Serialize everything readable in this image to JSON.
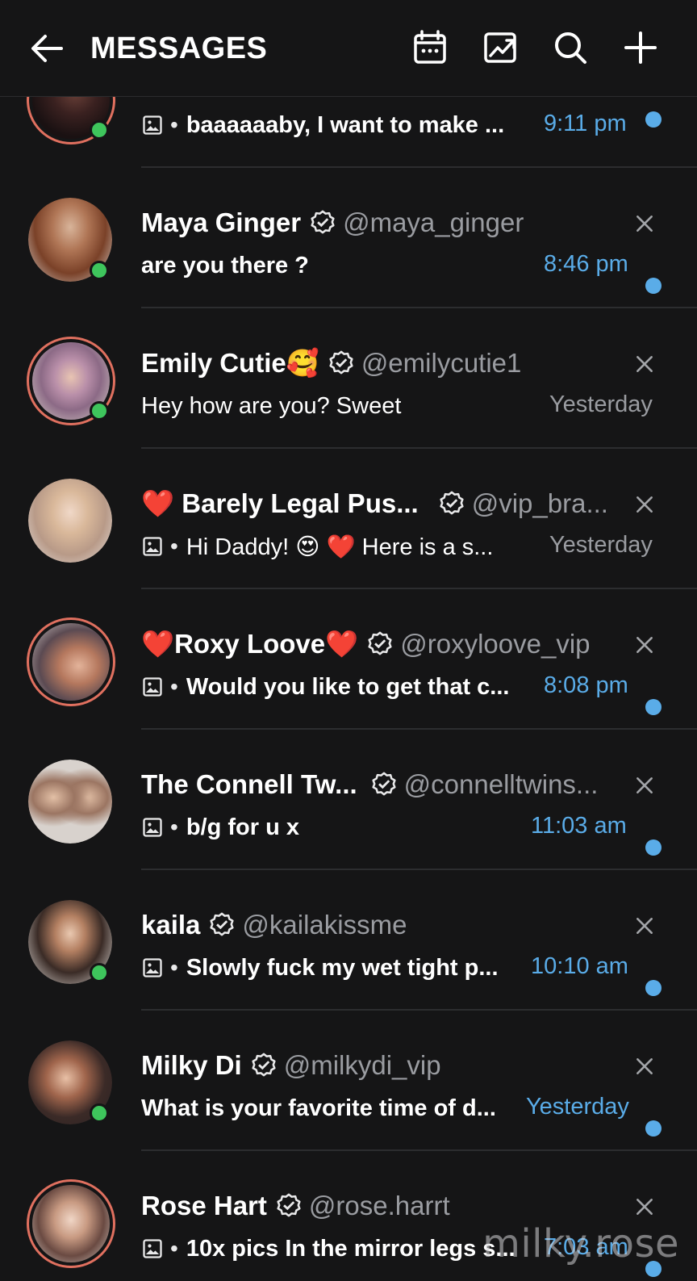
{
  "header": {
    "title": "MESSAGES"
  },
  "conversations": [
    {
      "name": "",
      "handle": "",
      "has_media": true,
      "message": "baaaaaaby, I want to make ...",
      "time": "9:11 pm",
      "unread": true,
      "online": true,
      "story_ring": true
    },
    {
      "name": "Maya Ginger",
      "handle": "@maya_ginger",
      "has_media": false,
      "message": "are you there ?",
      "time": "8:46 pm",
      "unread": true,
      "online": true,
      "story_ring": false
    },
    {
      "name": "Emily Cutie🥰",
      "handle": "@emilycutie1",
      "has_media": false,
      "message": "Hey how are you? Sweet",
      "time": "Yesterday",
      "unread": false,
      "online": true,
      "story_ring": true
    },
    {
      "name": "❤️ Barely Legal Pus...",
      "handle": "@vip_bra...",
      "has_media": true,
      "message": "Hi Daddy! 😍 ❤️ Here is a s...",
      "time": "Yesterday",
      "unread": false,
      "online": false,
      "story_ring": false
    },
    {
      "name": "❤️Roxy Loove❤️",
      "handle": "@roxyloove_vip",
      "has_media": true,
      "message": "Would you like to get that c...",
      "time": "8:08 pm",
      "unread": true,
      "online": false,
      "story_ring": true
    },
    {
      "name": "The Connell Tw...",
      "handle": "@connelltwins...",
      "has_media": true,
      "message": "b/g for u x",
      "time": "11:03 am",
      "unread": true,
      "online": false,
      "story_ring": false
    },
    {
      "name": "kaila",
      "handle": "@kailakissme",
      "has_media": true,
      "message": "Slowly fuck my wet tight p...",
      "time": "10:10 am",
      "unread": true,
      "online": true,
      "story_ring": false
    },
    {
      "name": "Milky Di",
      "handle": "@milkydi_vip",
      "has_media": false,
      "message": "What is your favorite time of d...",
      "time": "Yesterday",
      "unread": true,
      "online": true,
      "story_ring": false
    },
    {
      "name": "Rose Hart",
      "handle": "@rose.harrt",
      "has_media": true,
      "message": "10x pics In the mirror legs s...",
      "time": "7:03 am",
      "unread": true,
      "online": false,
      "story_ring": true
    }
  ],
  "watermark": "milky.rose",
  "icons": {
    "back": "arrow-left-icon",
    "calendar": "calendar-icon",
    "media": "image-chart-icon",
    "search": "search-icon",
    "add": "plus-icon",
    "verified": "verified-badge-icon",
    "close": "close-icon",
    "attachment": "image-icon"
  },
  "colors": {
    "background": "#151516",
    "accent": "#5aace8",
    "online": "#3ec55c",
    "story_ring": "#e0705f",
    "muted_text": "#9a9ca1"
  }
}
